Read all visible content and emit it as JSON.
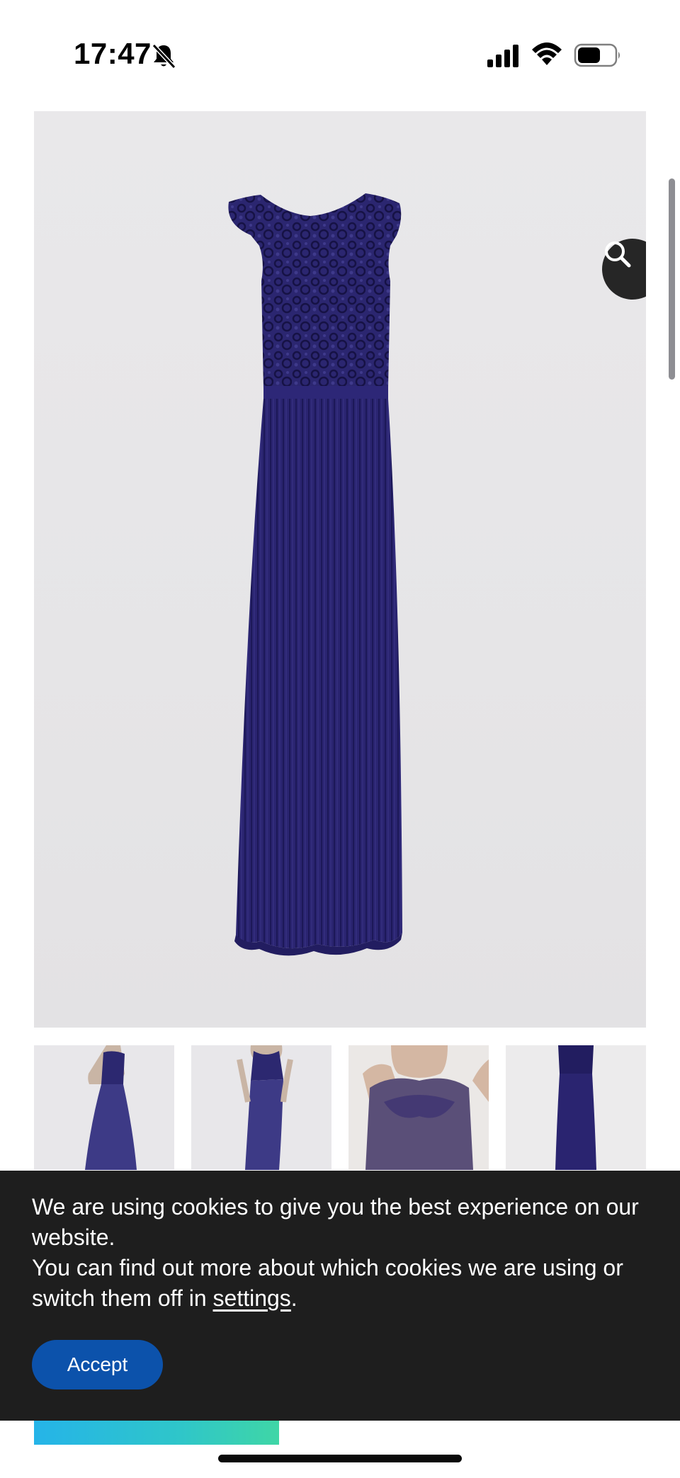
{
  "status_bar": {
    "time": "17:47",
    "icons": [
      "bell-slash-icon",
      "cellular-signal-icon",
      "wifi-icon",
      "battery-icon"
    ]
  },
  "product": {
    "main_image": "navy-lace-pleated-maxi-dress",
    "zoom_icon": "search-icon",
    "thumbnails": [
      "thumbnail-model-back-view",
      "thumbnail-model-front-view",
      "thumbnail-lace-bodice-closeup",
      "thumbnail-dress-flat"
    ]
  },
  "cookie_banner": {
    "line1": "We are using cookies to give you the best experience on our website.",
    "line2_prefix": "You can find out more about which cookies we are using or switch them off in ",
    "settings_link": "settings",
    "line2_suffix": ".",
    "accept_label": "Accept"
  },
  "colors": {
    "dress_navy": "#28226b",
    "banner_bg": "#1e1e1e",
    "accept_blue": "#0c52ab"
  }
}
